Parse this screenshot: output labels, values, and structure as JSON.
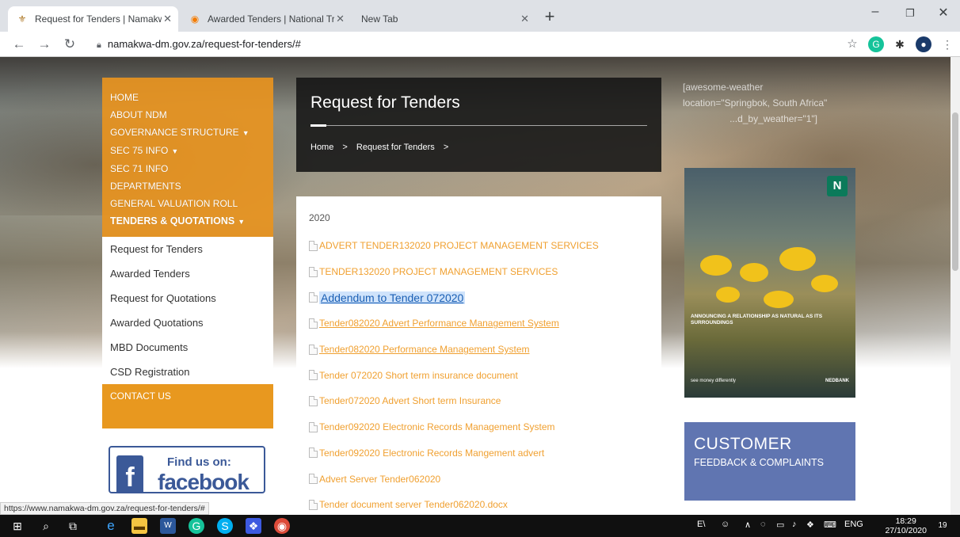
{
  "browser": {
    "tabs": [
      {
        "label": "Request for Tenders | Namakwa D",
        "icon": "namakwa-crest-icon",
        "active": true
      },
      {
        "label": "Awarded Tenders | National Treas",
        "icon": "treasury-logo-icon",
        "active": false
      },
      {
        "label": "New Tab",
        "icon": "",
        "active": false
      }
    ],
    "new_tab": "+",
    "window_controls": [
      "–",
      "❐",
      "✕"
    ],
    "url": "namakwa-dm.gov.za/request-for-tenders/#",
    "status_url": "https://www.namakwa-dm.gov.za/request-for-tenders/#"
  },
  "nav": {
    "items": [
      {
        "label": "HOME",
        "caret": ""
      },
      {
        "label": "ABOUT NDM",
        "caret": ""
      },
      {
        "label": "GOVERNANCE STRUCTURE",
        "caret": "▼"
      },
      {
        "label": "SEC 75 INFO",
        "caret": "▼"
      },
      {
        "label": "SEC 71 INFO",
        "caret": ""
      },
      {
        "label": "DEPARTMENTS",
        "caret": ""
      },
      {
        "label": "GENERAL VALUATION ROLL",
        "caret": ""
      },
      {
        "label": "TENDERS & QUOTATIONS",
        "caret": "▼"
      }
    ],
    "subitems": [
      "Request for Tenders",
      "Awarded Tenders",
      "Request for Quotations",
      "Awarded Quotations",
      "MBD Documents",
      "CSD Registration"
    ],
    "contact": "CONTACT US"
  },
  "facebook": {
    "find": "Find us on:",
    "word": "facebook"
  },
  "header": {
    "title": "Request for Tenders",
    "breadcrumb": [
      "Home",
      ">",
      "Request for Tenders",
      ">"
    ]
  },
  "content": {
    "year": "2020",
    "documents": [
      {
        "label": "ADVERT TENDER132020 PROJECT MANAGEMENT SERVICES",
        "style": ""
      },
      {
        "label": "TENDER132020 PROJECT MANAGEMENT SERVICES",
        "style": ""
      },
      {
        "label": "Addendum to Tender 072020",
        "style": "selected"
      },
      {
        "label": "Tender082020 Advert Performance Management System",
        "style": "underline"
      },
      {
        "label": "Tender082020 Performance Management System",
        "style": "underline"
      },
      {
        "label": "Tender 072020 Short term insurance document",
        "style": ""
      },
      {
        "label": "Tender072020 Advert Short term Insurance",
        "style": ""
      },
      {
        "label": "Tender092020 Electronic Records Management System",
        "style": ""
      },
      {
        "label": "Tender092020 Electronic Records Mangement advert",
        "style": ""
      },
      {
        "label": "Advert Server Tender062020",
        "style": ""
      },
      {
        "label": "Tender document server Tender062020.docx",
        "style": ""
      }
    ]
  },
  "weather": {
    "line1": "[awesome-weather",
    "line2": "location=\"Springbok, South Africa\"",
    "line3": "...d_by_weather=\"1\"]"
  },
  "ad": {
    "headline": "ANNOUNCING A RELATIONSHIP AS NATURAL AS ITS SURROUNDINGS",
    "tagline": "see money differently",
    "brand": "NEDBANK"
  },
  "feedback": {
    "title": "CUSTOMER",
    "subtitle": "FEEDBACK & COMPLAINTS"
  },
  "taskbar": {
    "tray": [
      "E\\",
      "ENG"
    ],
    "time": "18:29",
    "date": "27/10/2020",
    "notifications": "19"
  },
  "colors": {
    "nav_orange": "#e8981f",
    "link_orange": "#f0a030",
    "feedback_blue": "#6075b1"
  }
}
